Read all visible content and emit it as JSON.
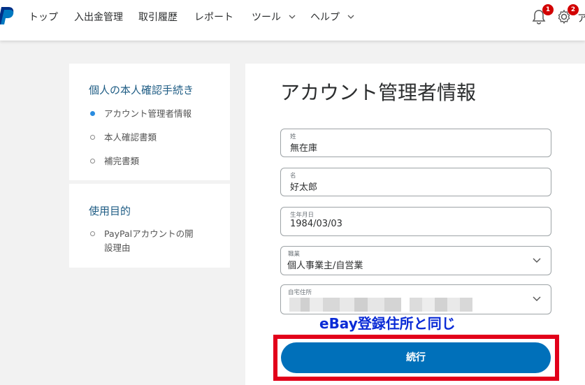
{
  "nav": {
    "items": [
      {
        "label": "トップ"
      },
      {
        "label": "入出金管理"
      },
      {
        "label": "取引履歴"
      },
      {
        "label": "レポート"
      },
      {
        "label": "ツール"
      },
      {
        "label": "ヘルプ"
      }
    ],
    "notifications_count": "1",
    "settings_count": "2",
    "user_initial": "ア"
  },
  "sidebar": {
    "section1_title": "個人の本人確認手続き",
    "section1_items": [
      {
        "label": "アカウント管理者情報",
        "active": true
      },
      {
        "label": "本人確認書類",
        "active": false
      },
      {
        "label": "補完書類",
        "active": false
      }
    ],
    "section2_title": "使用目的",
    "section2_items": [
      {
        "label_line1": "PayPalアカウントの開",
        "label_line2": "設理由",
        "active": false
      }
    ]
  },
  "main": {
    "title": "アカウント管理者情報",
    "fields": {
      "last_name": {
        "label": "姓",
        "value": "無在庫"
      },
      "first_name": {
        "label": "名",
        "value": "好太郎"
      },
      "birthdate": {
        "label": "生年月日",
        "value": "1984/03/03"
      },
      "occupation": {
        "label": "職業",
        "value": "個人事業主/自営業"
      },
      "address": {
        "label": "自宅住所",
        "value": ""
      }
    },
    "annotation": "eBay登録住所と同じ",
    "continue_label": "続行"
  },
  "colors": {
    "brand_blue": "#0070ba",
    "step_title": "#1e5c84",
    "badge": "#d20000",
    "highlight": "#e2001a",
    "annotation": "#0a2bd6"
  }
}
